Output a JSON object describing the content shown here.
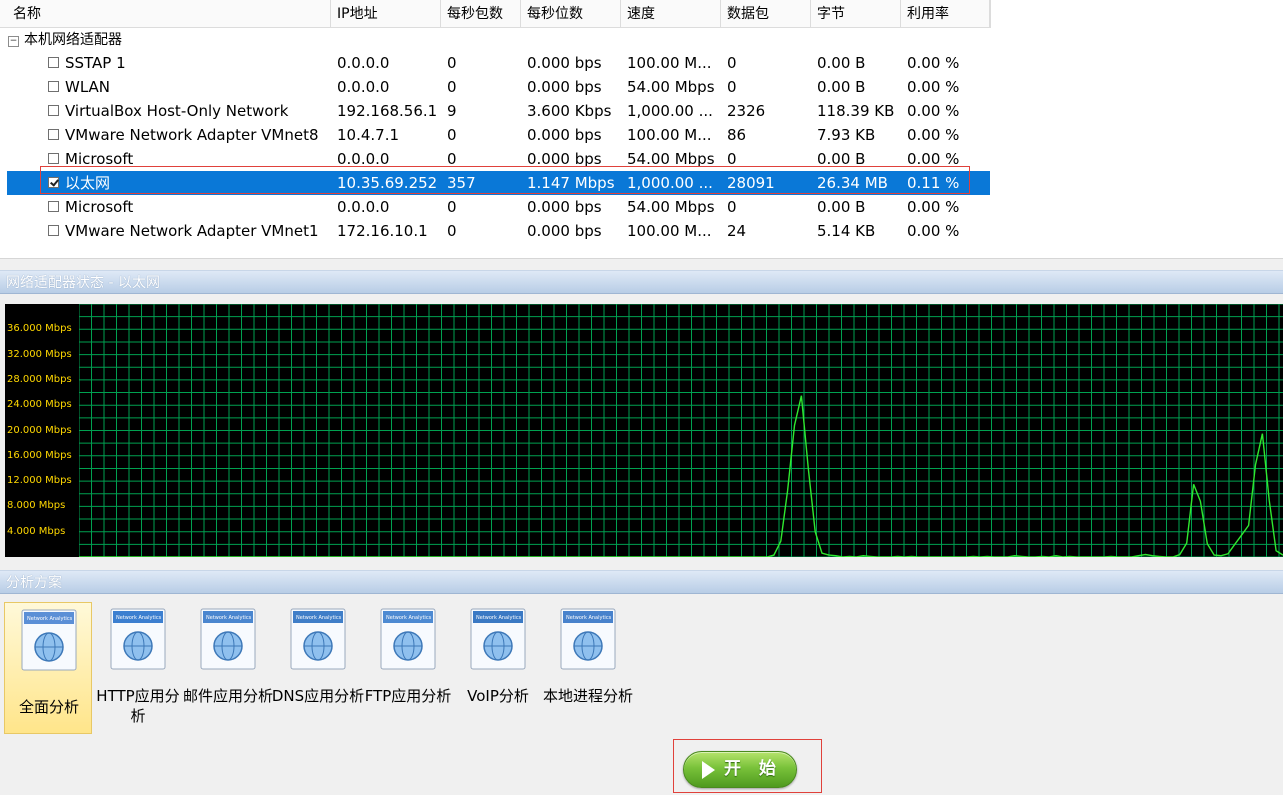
{
  "adapter_list": {
    "columns": [
      "名称",
      "IP地址",
      "每秒包数",
      "每秒位数",
      "速度",
      "数据包",
      "字节",
      "利用率"
    ],
    "group_label": "本机网络适配器",
    "rows": [
      {
        "name": "SSTAP 1",
        "ip": "0.0.0.0",
        "pps": "0",
        "bps": "0.000 bps",
        "speed": "100.00 M...",
        "packets": "0",
        "bytes": "0.00 B",
        "util": "0.00 %",
        "checked": false
      },
      {
        "name": "WLAN",
        "ip": "0.0.0.0",
        "pps": "0",
        "bps": "0.000 bps",
        "speed": "54.00 Mbps",
        "packets": "0",
        "bytes": "0.00 B",
        "util": "0.00 %",
        "checked": false
      },
      {
        "name": "VirtualBox Host-Only Network",
        "ip": "192.168.56.1",
        "pps": "9",
        "bps": "3.600 Kbps",
        "speed": "1,000.00 ...",
        "packets": "2326",
        "bytes": "118.39 KB",
        "util": "0.00 %",
        "checked": false
      },
      {
        "name": "VMware Network Adapter VMnet8",
        "ip": "10.4.7.1",
        "pps": "0",
        "bps": "0.000 bps",
        "speed": "100.00 M...",
        "packets": "86",
        "bytes": "7.93 KB",
        "util": "0.00 %",
        "checked": false
      },
      {
        "name": "Microsoft",
        "ip": "0.0.0.0",
        "pps": "0",
        "bps": "0.000 bps",
        "speed": "54.00 Mbps",
        "packets": "0",
        "bytes": "0.00 B",
        "util": "0.00 %",
        "checked": false
      },
      {
        "name": "以太网",
        "ip": "10.35.69.252",
        "pps": "357",
        "bps": "1.147 Mbps",
        "speed": "1,000.00 ...",
        "packets": "28091",
        "bytes": "26.34 MB",
        "util": "0.11 %",
        "checked": true,
        "selected": true
      },
      {
        "name": "Microsoft",
        "ip": "0.0.0.0",
        "pps": "0",
        "bps": "0.000 bps",
        "speed": "54.00 Mbps",
        "packets": "0",
        "bytes": "0.00 B",
        "util": "0.00 %",
        "checked": false
      },
      {
        "name": "VMware Network Adapter VMnet1",
        "ip": "172.16.10.1",
        "pps": "0",
        "bps": "0.000 bps",
        "speed": "100.00 M...",
        "packets": "24",
        "bytes": "5.14 KB",
        "util": "0.00 %",
        "checked": false
      }
    ]
  },
  "status_section": {
    "title": "网络适配器状态 - 以太网"
  },
  "chart_data": {
    "type": "line",
    "y_ticks": [
      "36.000 Mbps",
      "32.000 Mbps",
      "28.000 Mbps",
      "24.000 Mbps",
      "20.000 Mbps",
      "16.000 Mbps",
      "12.000 Mbps",
      "8.000 Mbps",
      "4.000 Mbps"
    ],
    "ylim": [
      0,
      40
    ],
    "grid": true,
    "colors": {
      "background": "#000000",
      "grid": "#00a050",
      "line": "#2fe82f",
      "tick_text": "#ffd800"
    },
    "series": [
      {
        "values": [
          0,
          0,
          0,
          0,
          0,
          0,
          0,
          0,
          0,
          0,
          0,
          0,
          0,
          0,
          0,
          0,
          0,
          0,
          0,
          0,
          0,
          0,
          0,
          0,
          0,
          0,
          0,
          0,
          0,
          0,
          0,
          0,
          0,
          0,
          0,
          0,
          0,
          0,
          0,
          0,
          0,
          0,
          0,
          0,
          0,
          0,
          0,
          0,
          0,
          0,
          0,
          0,
          0,
          0,
          0,
          0,
          0,
          0,
          0,
          0,
          0,
          0,
          0,
          0,
          0,
          0,
          0,
          0,
          0,
          0,
          0,
          0,
          0,
          0,
          0,
          0,
          0,
          0,
          0,
          0,
          0,
          0,
          0,
          0,
          0,
          0,
          0,
          0,
          0,
          0,
          0,
          0,
          0,
          0,
          0,
          0,
          0,
          0,
          0,
          0,
          0,
          0.3,
          2.5,
          10.5,
          20.8,
          25.5,
          14.0,
          4.0,
          0.6,
          0.3,
          0.2,
          0,
          0.1,
          0,
          0.2,
          0.1,
          0,
          0,
          0,
          0.1,
          0,
          0.1,
          0,
          0,
          0,
          0,
          0,
          0,
          0,
          0,
          0.1,
          0,
          0.1,
          0,
          0,
          0,
          0.2,
          0.1,
          0,
          0,
          0.1,
          0,
          0.2,
          0,
          0.1,
          0,
          0,
          0,
          0,
          0,
          0.1,
          0,
          0,
          0,
          0.2,
          0.4,
          0.2,
          0.1,
          0,
          0,
          0.4,
          2.2,
          11.5,
          8.8,
          2.1,
          0.3,
          0.2,
          0.5,
          2.0,
          3.5,
          5.0,
          14.6,
          19.5,
          9.0,
          1.0,
          0.3
        ]
      }
    ]
  },
  "analysis_section": {
    "title": "分析方案",
    "tools": [
      {
        "label": "全面分析",
        "icon": "magnifier-analysis-icon",
        "active": true
      },
      {
        "label": "HTTP应用分析",
        "icon": "ie-globe-icon"
      },
      {
        "label": "邮件应用分析",
        "icon": "mail-envelope-icon"
      },
      {
        "label": "DNS应用分析",
        "icon": "dns-server-icon"
      },
      {
        "label": "FTP应用分析",
        "icon": "ftp-network-icon"
      },
      {
        "label": "VoIP分析",
        "icon": "headset-globe-icon"
      },
      {
        "label": "本地进程分析",
        "icon": "monitor-gear-icon"
      }
    ],
    "icon_caption": "Network Analytics"
  },
  "start_button": {
    "label": "开 始"
  }
}
